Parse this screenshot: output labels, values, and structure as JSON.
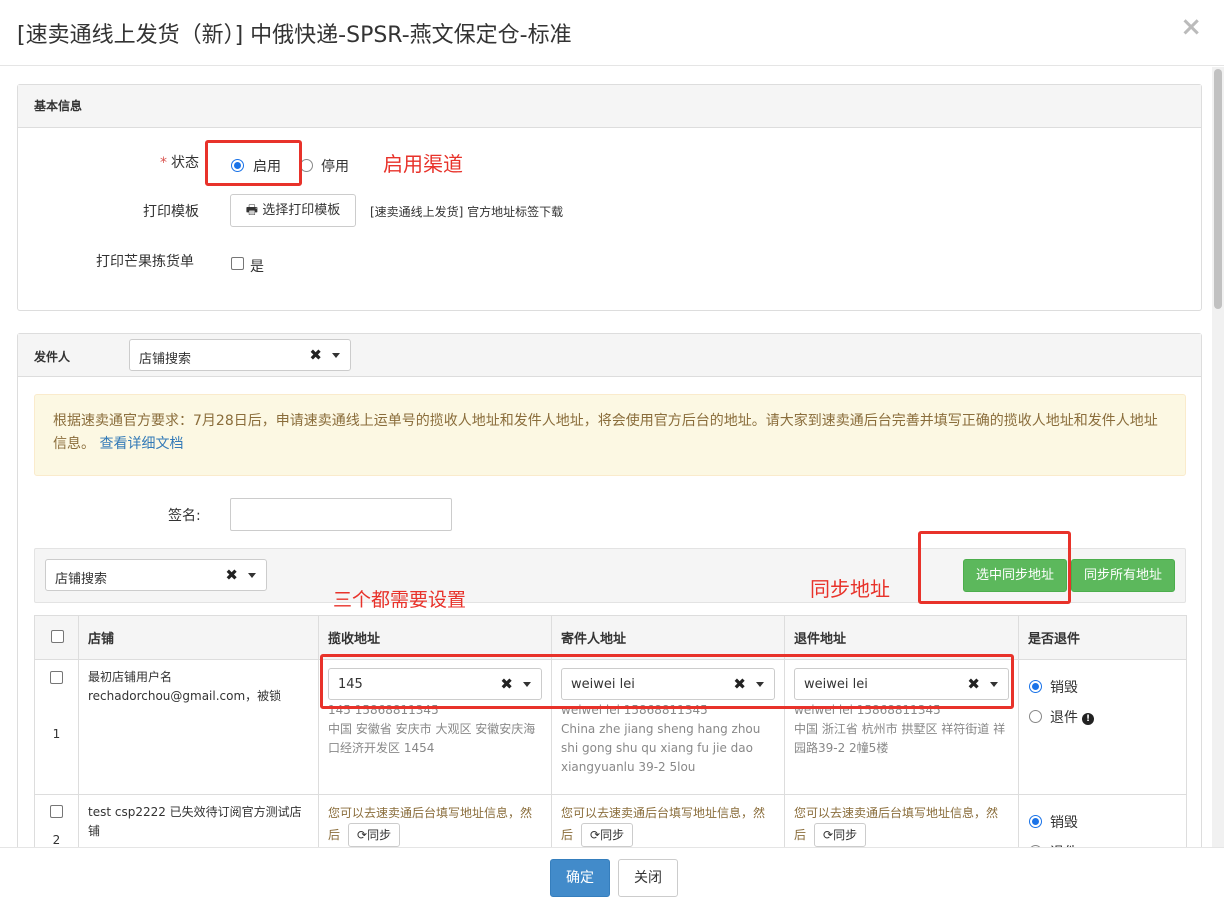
{
  "modal": {
    "title": "[速卖通线上发货（新）] 中俄快递-SPSR-燕文保定仓-标准",
    "close_glyph": "×"
  },
  "basic_info": {
    "heading": "基本信息",
    "status_label": "状态",
    "status_required_mark": "*",
    "status_options": [
      "启用",
      "停用"
    ],
    "status_selected": "启用",
    "print_template_label": "打印模板",
    "print_template_button": "选择打印模板",
    "print_template_desc": "[速卖通线上发货] 官方地址标签下载",
    "print_mango_label": "打印芒果拣货单",
    "print_mango_option": "是"
  },
  "sender": {
    "heading": "发件人",
    "store_search_placeholder": "店铺搜索",
    "alert_text": "根据速卖通官方要求：7月28日后，申请速卖通线上运单号的揽收人地址和发件人地址，将会使用官方后台的地址。请大家到速卖通后台完善并填写正确的揽收人地址和发件人地址信息。",
    "alert_link": "查看详细文档",
    "signature_label": "签名:",
    "signature_value": "",
    "toolbar_store_search": "店铺搜索",
    "sync_selected_button": "选中同步地址",
    "sync_all_button": "同步所有地址"
  },
  "table": {
    "headers": [
      "店铺",
      "揽收地址",
      "寄件人地址",
      "退件地址",
      "是否退件"
    ],
    "rows": [
      {
        "index": "1",
        "store_line1": "最初店铺用户名",
        "store_line2": "rechadorchou@gmail.com，被锁",
        "pickup_select": "145",
        "pickup_addr": "145 15868811345\n中国 安徽省 安庆市 大观区 安徽安庆海口经济开发区 1454",
        "sender_select": "weiwei lei",
        "sender_addr": "weiwei lei 15868811345\nChina zhe jiang sheng hang zhou shi gong shu qu xiang fu jie dao xiangyuanlu 39-2 5lou",
        "return_select": "weiwei lei",
        "return_addr": "weiwei lei 15868811345\n中国 浙江省 杭州市 拱墅区 祥符街道 祥园路39-2 2幢5楼",
        "return_options": [
          "销毁",
          "退件"
        ],
        "return_selected": "销毁"
      },
      {
        "index": "2",
        "store_line1": "test csp2222 已失效待订阅官方测试店铺",
        "pickup_warn": "您可以去速卖通后台填写地址信息，然后",
        "sender_warn": "您可以去速卖通后台填写地址信息，然后",
        "return_warn": "您可以去速卖通后台填写地址信息，然后",
        "sync_label": "同步",
        "return_options": [
          "销毁",
          "退件"
        ],
        "return_selected": "销毁"
      }
    ]
  },
  "annotations": {
    "enable_channel": "启用渠道",
    "sync_address": "同步地址",
    "all_three": "三个都需要设置"
  },
  "footer": {
    "confirm_button": "确定",
    "close_button": "关闭"
  },
  "colors": {
    "primary": "#428bca",
    "success": "#5cb85c",
    "annotation": "#e8322a",
    "alert_bg": "#fcf8e3"
  }
}
